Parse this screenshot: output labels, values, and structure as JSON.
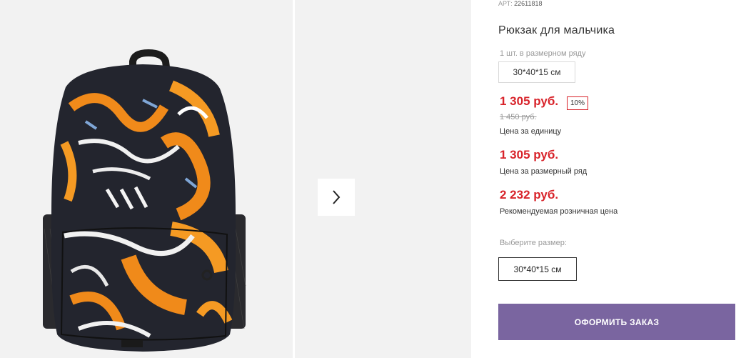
{
  "product": {
    "article_label": "АРТ:",
    "article_value": "22611818",
    "title": "Рюкзак для мальчика",
    "series_label": "1 шт. в размерном ряду",
    "series_size": "30*40*15 см"
  },
  "prices": {
    "unit_price": "1 305 руб.",
    "discount": "10%",
    "old_price": "1 450 руб.",
    "unit_caption": "Цена за единицу",
    "series_price": "1 305 руб.",
    "series_caption": "Цена за размерный ряд",
    "retail_price": "2 232 руб.",
    "retail_caption": "Рекомендуемая розничная цена"
  },
  "size_select": {
    "label": "Выберите размер:",
    "selected": "30*40*15 см"
  },
  "order": {
    "button_label": "ОФОРМИТЬ ЗАКАЗ"
  },
  "colors": {
    "price_red": "#d8232a",
    "order_purple": "#7a65a0",
    "gallery_bg": "#f2f2f2"
  },
  "icons": {
    "next": "chevron-right-icon"
  }
}
